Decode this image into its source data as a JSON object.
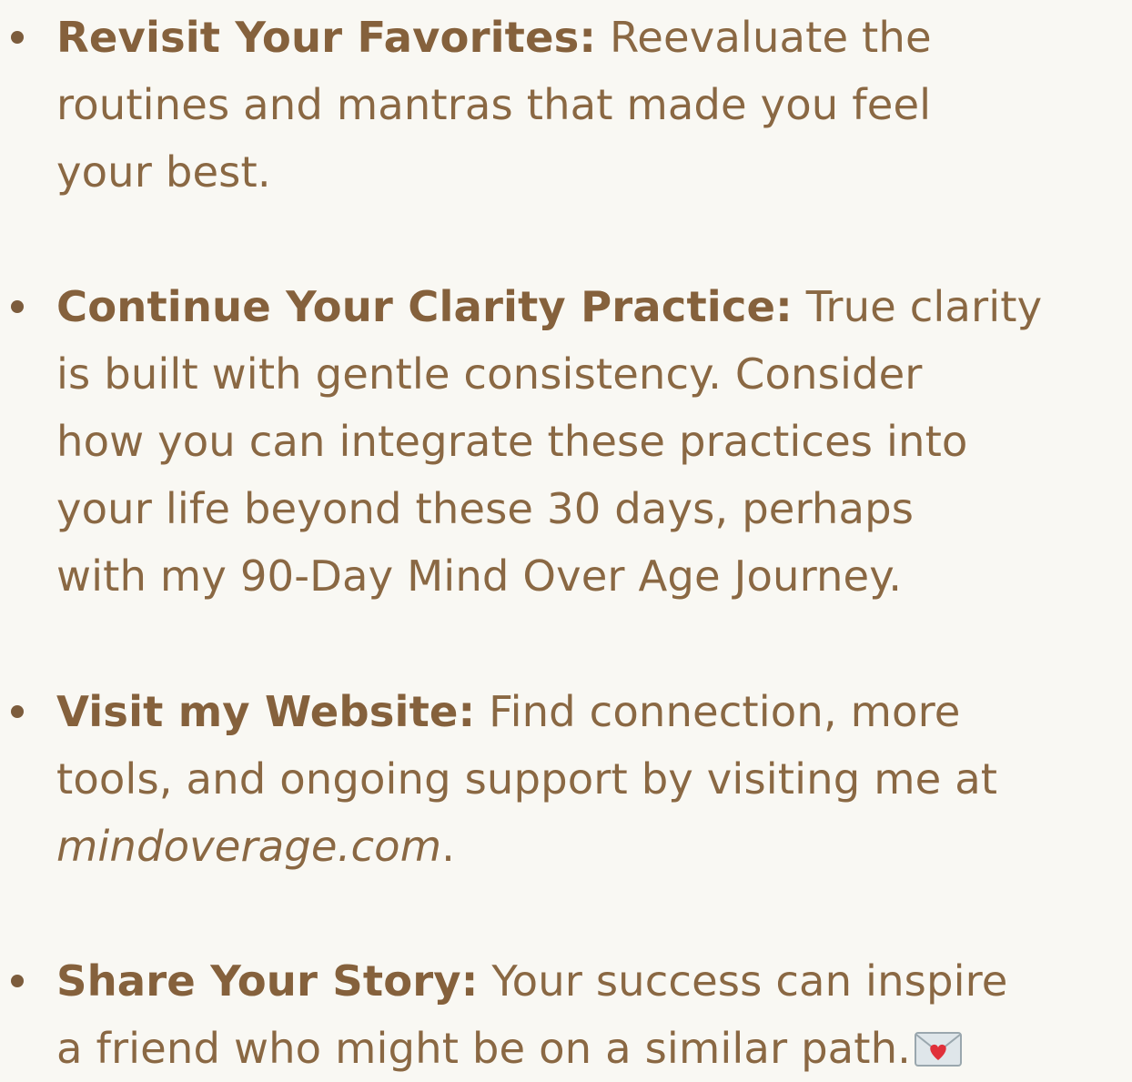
{
  "items": [
    {
      "term": "Revisit Your Favorites:",
      "lines": [
        "Reevaluate the",
        "routines and mantras that made you feel",
        "your best."
      ]
    },
    {
      "term": "Continue Your Clarity Practice:",
      "lines": [
        "True clarity",
        "is built with gentle consistency. Consider",
        "how you can integrate these practices into",
        "your life beyond these 30 days, perhaps",
        "with my 90-Day Mind Over Age Journey."
      ]
    },
    {
      "term": "Visit my Website:",
      "lines": [
        "Find connection, more",
        "tools, and ongoing support by visiting me at"
      ],
      "link": "mindoverage.com",
      "link_suffix": "."
    },
    {
      "term": "Share Your Story:",
      "lines": [
        "Your success can inspire",
        "a friend who might be on a similar path."
      ],
      "icon": "love-letter-icon"
    }
  ],
  "colors": {
    "background": "#f9f8f3",
    "text": "#8a6843",
    "bullet": "#7c5c3c"
  }
}
